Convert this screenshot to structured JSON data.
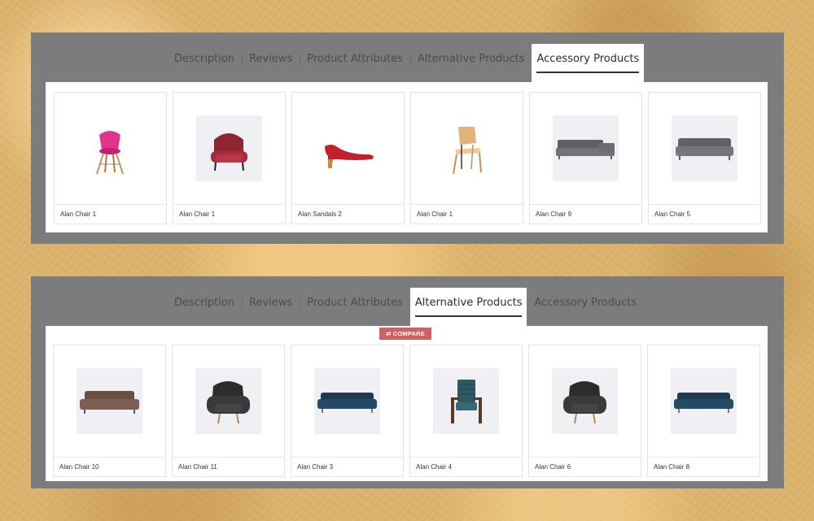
{
  "panels": [
    {
      "tabs": [
        "Description",
        "Reviews",
        "Product Attributes",
        "Alternative Products",
        "Accessory Products"
      ],
      "active_tab": "Accessory Products",
      "products": [
        {
          "name": "Alan Chair 1",
          "icon": "pink-chair-icon"
        },
        {
          "name": "Alan Chair 1",
          "icon": "red-armchair-icon"
        },
        {
          "name": "Alan Sandals 2",
          "icon": "red-heel-shoe-icon"
        },
        {
          "name": "Alan Chair 1",
          "icon": "wood-chair-icon"
        },
        {
          "name": "Alan Chair 9",
          "icon": "grey-sectional-sofa-icon"
        },
        {
          "name": "Alan Chair 5",
          "icon": "grey-sofa-icon"
        }
      ]
    },
    {
      "tabs": [
        "Description",
        "Reviews",
        "Product Attributes",
        "Alternative Products",
        "Accessory Products"
      ],
      "active_tab": "Alternative Products",
      "compare_label": "⇄ COMPARE",
      "products": [
        {
          "name": "Alan Chair 10",
          "icon": "brown-sofa-icon"
        },
        {
          "name": "Alan Chair 11",
          "icon": "black-armchair-icon"
        },
        {
          "name": "Alan Chair 3",
          "icon": "navy-sofa-icon"
        },
        {
          "name": "Alan Chair 4",
          "icon": "teal-lounge-chair-icon"
        },
        {
          "name": "Alan Chair 6",
          "icon": "black-armchair-icon"
        },
        {
          "name": "Alan Chair 8",
          "icon": "navy-sofa-icon"
        }
      ]
    }
  ],
  "colors": {
    "panel": "#7c7c7c",
    "compare": "#d36060",
    "background": "#dcb36e"
  }
}
